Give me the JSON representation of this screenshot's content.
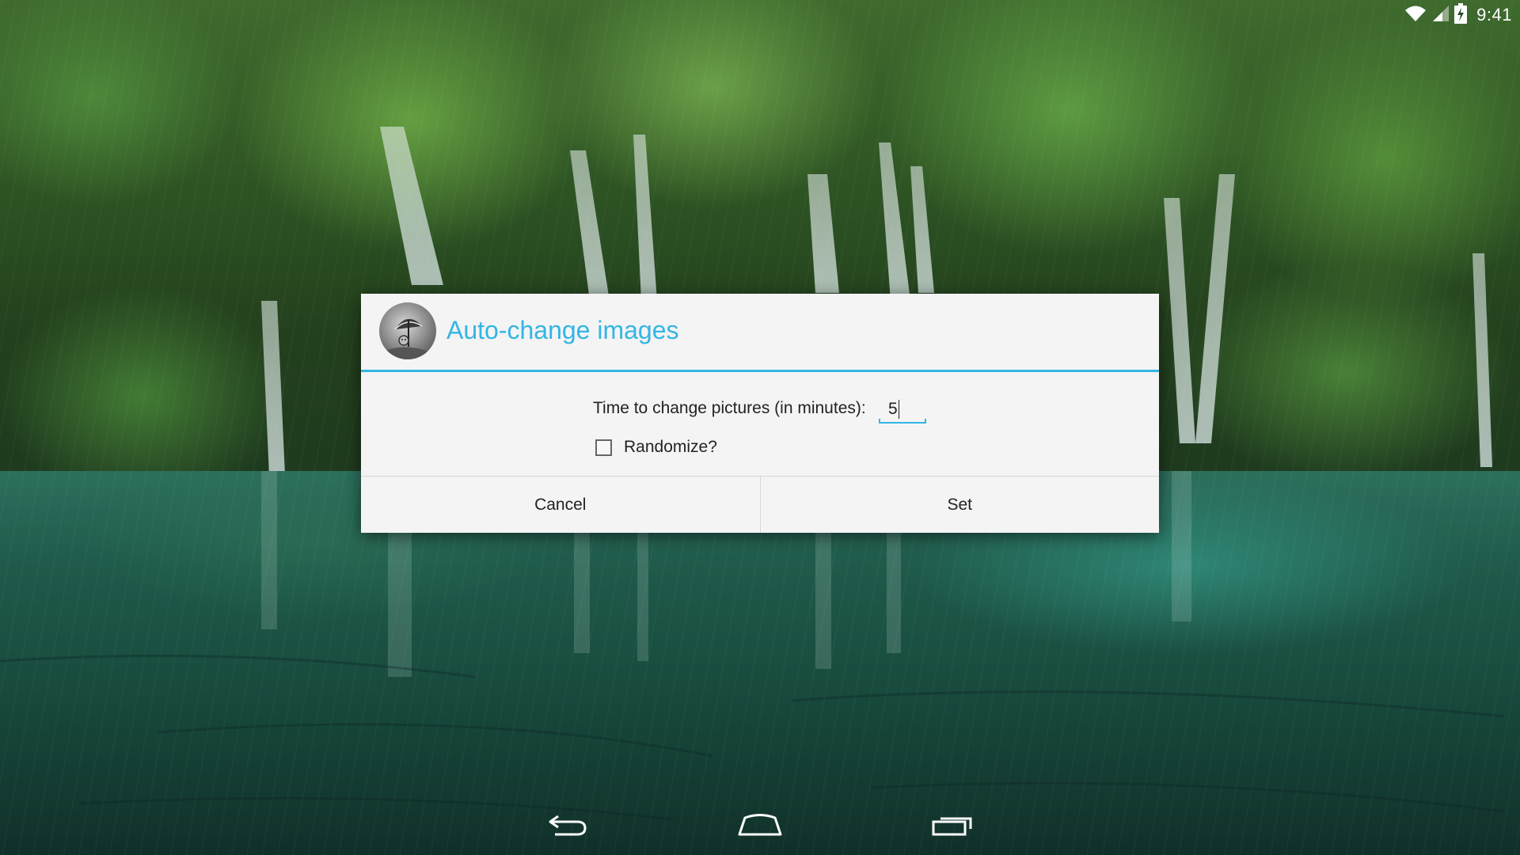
{
  "status_bar": {
    "time": "9:41",
    "icons": [
      "wifi-icon",
      "cell-signal-icon",
      "battery-charging-icon"
    ]
  },
  "dialog": {
    "title": "Auto-change images",
    "app_icon": "umbrella-avatar-icon",
    "interval_label": "Time to change pictures (in minutes):",
    "interval_value": "5",
    "randomize_label": "Randomize?",
    "randomize_checked": false,
    "cancel_label": "Cancel",
    "set_label": "Set",
    "accent_color": "#33b5e5"
  },
  "nav_bar": {
    "icons": [
      "back-icon",
      "home-icon",
      "recents-icon"
    ]
  }
}
